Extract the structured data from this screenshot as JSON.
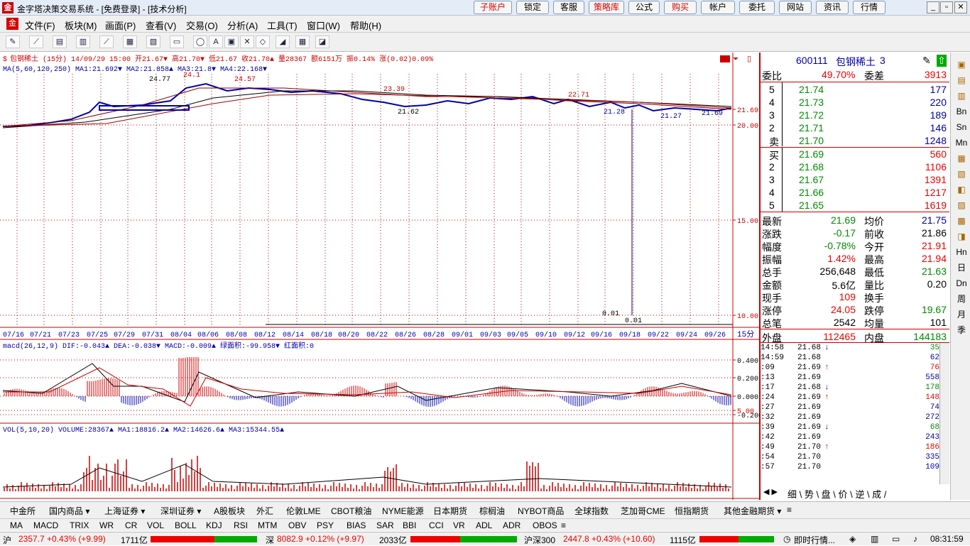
{
  "window": {
    "title": "金字塔决策交易系统 - [免费登录] - [技术分析]",
    "buttons": [
      "子账户",
      "锁定",
      "客服",
      "策略库",
      "公式",
      "购买",
      "帐户",
      "委托",
      "网站",
      "资讯",
      "行情"
    ]
  },
  "menu": [
    "文件(F)",
    "板块(M)",
    "画面(P)",
    "查看(V)",
    "交易(O)",
    "分析(A)",
    "工具(T)",
    "窗口(W)",
    "帮助(H)"
  ],
  "chart": {
    "header": "包钢稀土 (15分) 14/09/29 15:00 开21.67▼ 高21.70▼ 低21.67 收21.70▲ 量28367 额6151万 振0.14% 涨(0.02)0.09%",
    "ma_line": "MA(5,60,120,250) MA1:21.692▼ MA2:21.858▲ MA3:21.8▼ MA4:22.168▼",
    "price_labels": [
      "21.69",
      "20.00",
      "15.00",
      "10.00",
      "5.00"
    ],
    "low_labels": [
      "0.01",
      "0.01"
    ],
    "dates": [
      "07/16",
      "07/21",
      "07/23",
      "07/25",
      "07/29",
      "07/31",
      "08/04",
      "08/06",
      "08/08",
      "08/12",
      "08/14",
      "08/18",
      "08/20",
      "08/22",
      "08/26",
      "08/28",
      "09/01",
      "09/03",
      "09/05",
      "09/10",
      "09/12",
      "09/16",
      "09/18",
      "09/22",
      "09/24",
      "09/26"
    ],
    "period": "15分",
    "macd_line": "macd(26,12,9) DIF:-0.043▲ DEA:-0.038▼ MACD:-0.009▲ 绿面积:-99.958▼ 红面积:0",
    "macd_labels": [
      "0.400",
      "0.200",
      "0.000",
      "-0.200"
    ],
    "vol_line": "VOL(5,10,20) VOLUME:28367▲ MA1:18816.2▲ MA2:14626.6▲ MA3:15344.55▲"
  },
  "quote": {
    "code": "600111",
    "name": "包钢稀土",
    "num": "3",
    "webi_label": "委比",
    "webi": "49.70%",
    "wecha_label": "委差",
    "wecha": "3913",
    "sell": [
      {
        "lvl": "5",
        "p": "21.74",
        "v": "177"
      },
      {
        "lvl": "4",
        "p": "21.73",
        "v": "220"
      },
      {
        "lvl": "3",
        "p": "21.72",
        "v": "189"
      },
      {
        "lvl": "2",
        "p": "21.71",
        "v": "146"
      },
      {
        "lvl": "卖",
        "p": "21.70",
        "v": "1248"
      }
    ],
    "buy": [
      {
        "lvl": "买",
        "p": "21.69",
        "v": "560"
      },
      {
        "lvl": "2",
        "p": "21.68",
        "v": "1106"
      },
      {
        "lvl": "3",
        "p": "21.67",
        "v": "1391"
      },
      {
        "lvl": "4",
        "p": "21.66",
        "v": "1217"
      },
      {
        "lvl": "5",
        "p": "21.65",
        "v": "1619"
      }
    ],
    "stats": [
      {
        "l": "最新",
        "v": "21.69",
        "l2": "均价",
        "v2": "21.75"
      },
      {
        "l": "涨跌",
        "v": "-0.17",
        "l2": "前收",
        "v2": "21.86"
      },
      {
        "l": "幅度",
        "v": "-0.78%",
        "l2": "今开",
        "v2": "21.91"
      },
      {
        "l": "振幅",
        "v": "1.42%",
        "l2": "最高",
        "v2": "21.94"
      },
      {
        "l": "总手",
        "v": "256,648",
        "l2": "最低",
        "v2": "21.63"
      },
      {
        "l": "金额",
        "v": "5.6亿",
        "l2": "量比",
        "v2": "0.20"
      },
      {
        "l": "现手",
        "v": "109",
        "l2": "换手",
        "v2": ""
      },
      {
        "l": "涨停",
        "v": "24.05",
        "l2": "跌停",
        "v2": "19.67"
      },
      {
        "l": "总笔",
        "v": "2542",
        "l2": "均量",
        "v2": "101"
      }
    ],
    "outer_label": "外盘",
    "outer": "112465",
    "inner_label": "内盘",
    "inner": "144183",
    "ticks": [
      {
        "t": "14:58",
        "p": "21.68",
        "a": "↓",
        "v": "35"
      },
      {
        "t": "14:59",
        "p": "21.68",
        "a": "",
        "v": "62"
      },
      {
        "t": ":09",
        "p": "21.69",
        "a": "↑",
        "v": "76"
      },
      {
        "t": ":13",
        "p": "21.69",
        "a": "",
        "v": "558"
      },
      {
        "t": ":17",
        "p": "21.68",
        "a": "↓",
        "v": "178"
      },
      {
        "t": ":24",
        "p": "21.69",
        "a": "↑",
        "v": "148"
      },
      {
        "t": ":27",
        "p": "21.69",
        "a": "",
        "v": "74"
      },
      {
        "t": ":32",
        "p": "21.69",
        "a": "",
        "v": "272"
      },
      {
        "t": ":39",
        "p": "21.69",
        "a": "↓",
        "v": "68"
      },
      {
        "t": ":42",
        "p": "21.69",
        "a": "",
        "v": "243"
      },
      {
        "t": ":49",
        "p": "21.70",
        "a": "↑",
        "v": "186"
      },
      {
        "t": ":54",
        "p": "21.70",
        "a": "",
        "v": "335"
      },
      {
        "t": ":57",
        "p": "21.70",
        "a": "",
        "v": "109"
      }
    ],
    "tabs": "细 \\ 势 \\ 盘 \\ 价 \\ 逆 \\ 成 /"
  },
  "righttools": [
    "Bn",
    "Sn",
    "Mn",
    "Hn",
    "日",
    "Dn",
    "周",
    "月",
    "季"
  ],
  "market_tabs": [
    "中金所",
    "国内商品 ▾",
    "上海证券 ▾",
    "深圳证券 ▾",
    "A股板块",
    "外汇",
    "伦敦LME",
    "CBOT粮油",
    "NYME能源",
    "日本期货",
    "棕榈油",
    "NYBOT商品",
    "全球指数",
    "芝加哥CME",
    "恒指期货",
    "其他金融期货 ▾"
  ],
  "indicator_tabs": [
    "MA",
    "MACD",
    "TRIX",
    "WR",
    "CR",
    "VOL",
    "BOLL",
    "KDJ",
    "RSI",
    "MTM",
    "OBV",
    "PSY",
    "BIAS",
    "SAR",
    "BBI",
    "CCI",
    "VR",
    "ADL",
    "ADR",
    "OBOS"
  ],
  "status": {
    "sh_label": "沪",
    "sh": "2357.7 +0.43% (+9.99)",
    "sh_amt": "1711亿",
    "sz_label": "深",
    "sz": "8082.9 +0.12% (+9.97)",
    "sz_amt": "2033亿",
    "hs_label": "沪深300",
    "hs": "2447.8 +0.43% (+10.60)",
    "hs_amt": "1115亿",
    "info": "即时行情...",
    "time": "08:31:59"
  }
}
